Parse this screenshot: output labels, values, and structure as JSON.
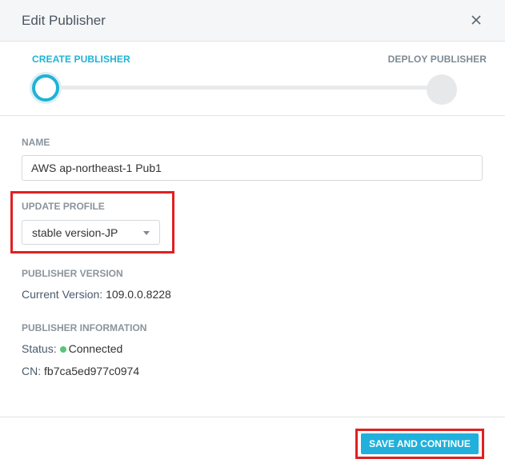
{
  "dialog": {
    "title": "Edit Publisher",
    "close_icon": "close-icon"
  },
  "stepper": {
    "steps": [
      {
        "label": "CREATE PUBLISHER",
        "state": "active"
      },
      {
        "label": "DEPLOY PUBLISHER",
        "state": "inactive"
      }
    ],
    "accent_color": "#1fb3d6"
  },
  "form": {
    "name_label": "NAME",
    "name_value": "AWS ap-northeast-1 Pub1",
    "update_profile_label": "UPDATE PROFILE",
    "update_profile_selected": "stable version-JP",
    "publisher_version_label": "PUBLISHER VERSION",
    "current_version_key": "Current Version:",
    "current_version_value": "109.0.0.8228",
    "publisher_info_label": "PUBLISHER INFORMATION",
    "status_key": "Status:",
    "status_value": "Connected",
    "status_color": "#5bc47a",
    "cn_key": "CN:",
    "cn_value": "fb7ca5ed977c0974"
  },
  "footer": {
    "save_label": "SAVE AND CONTINUE",
    "button_color": "#21b0db"
  },
  "annotations": {
    "highlight_color": "#e02020"
  }
}
